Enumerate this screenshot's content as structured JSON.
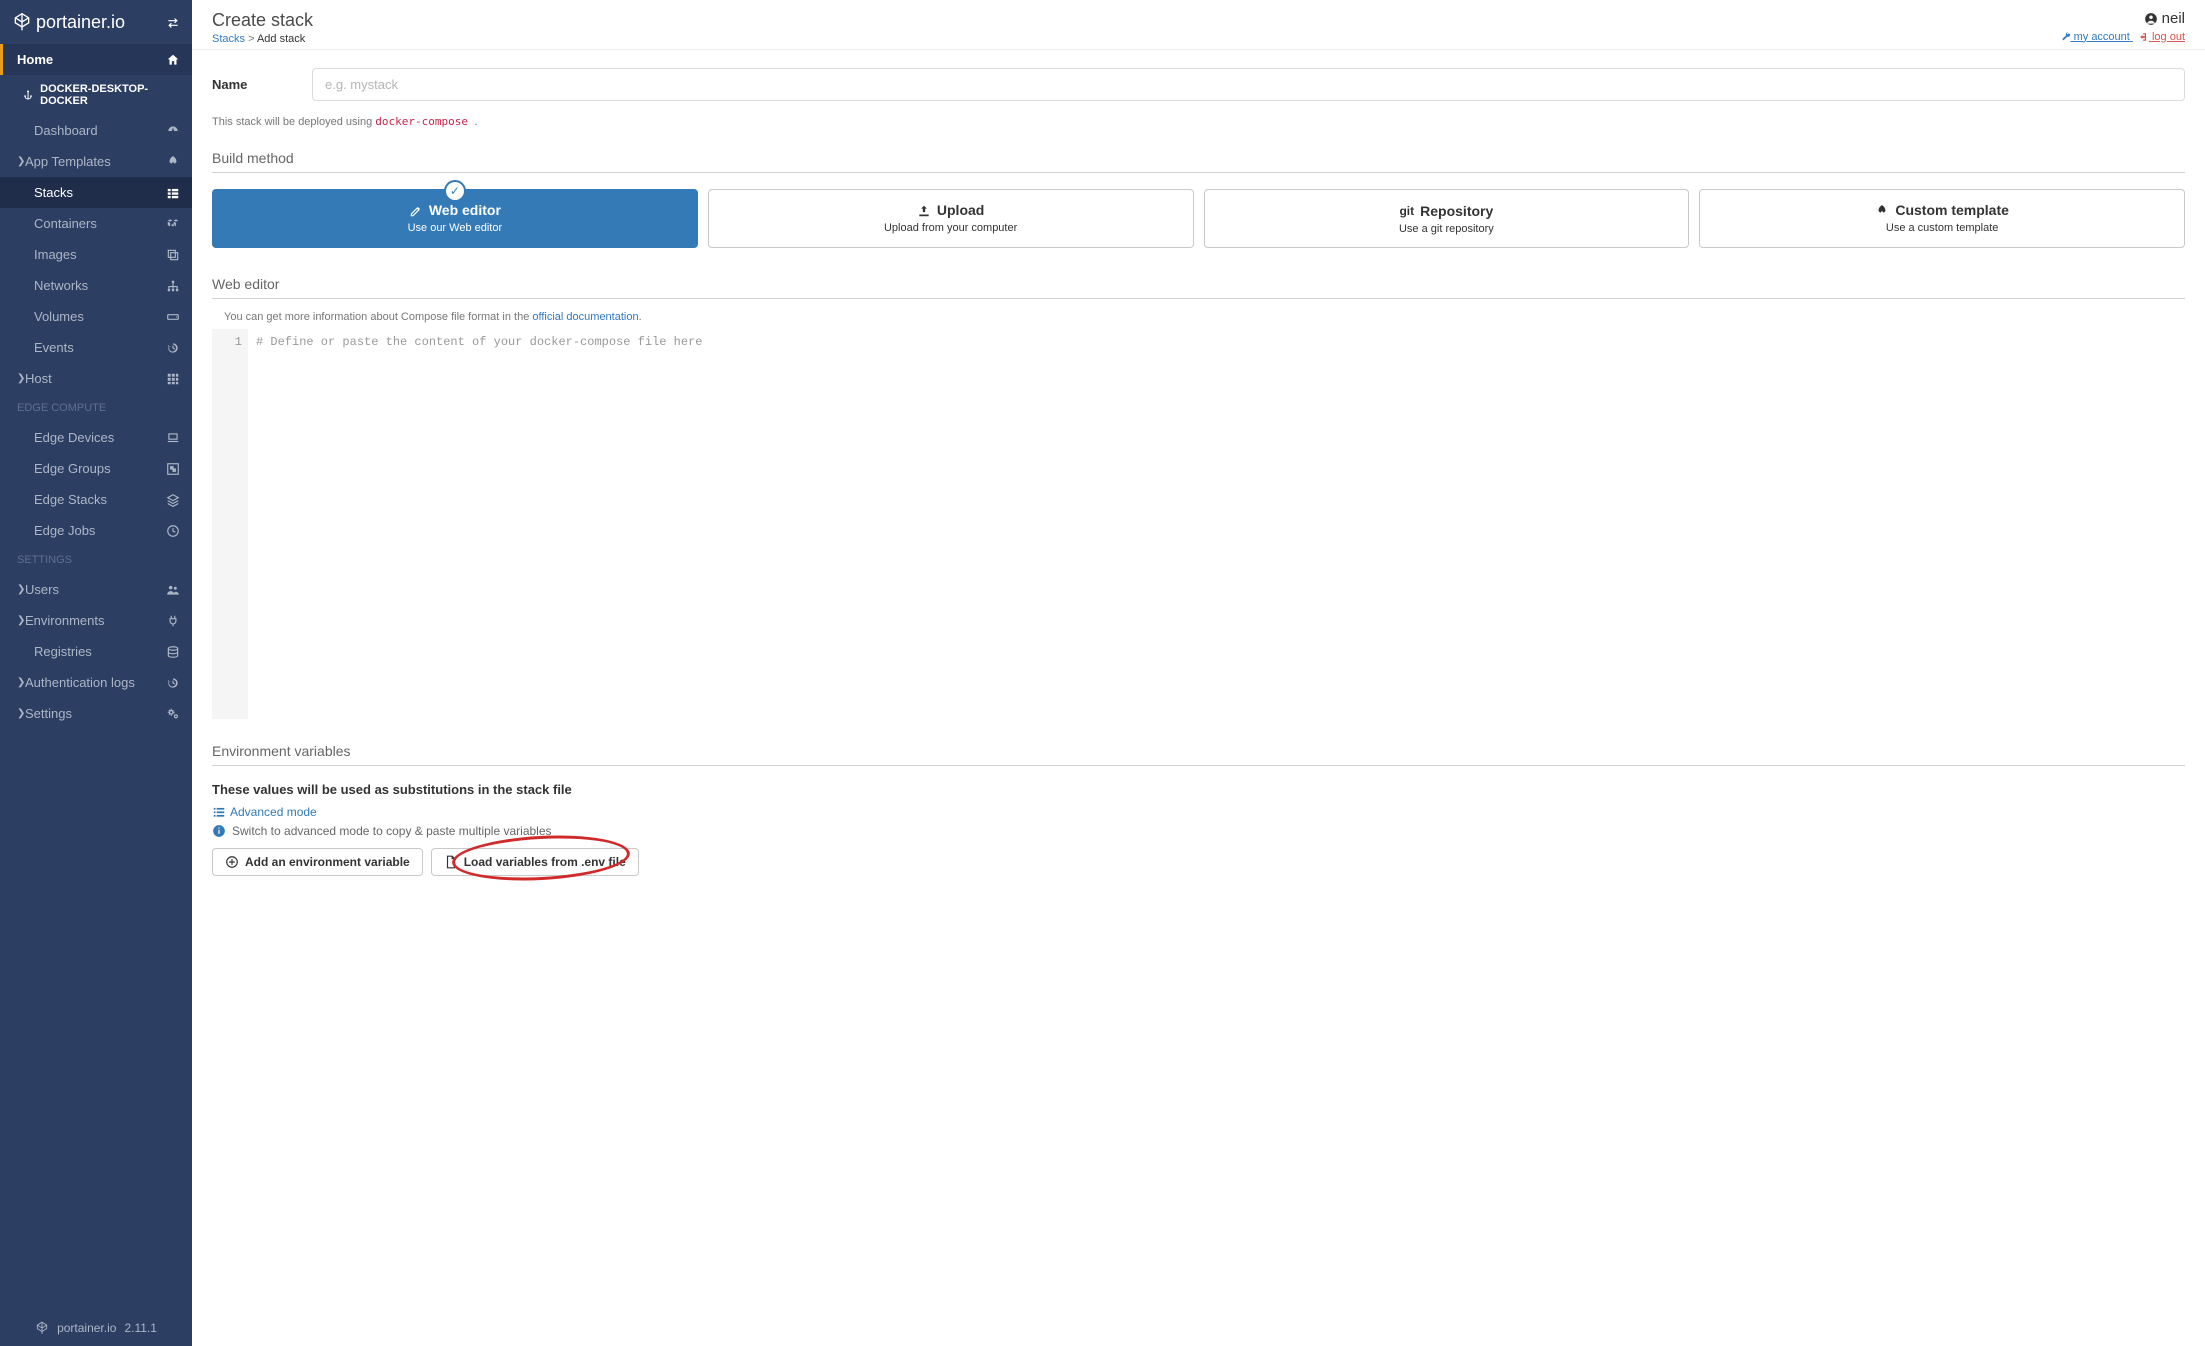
{
  "brand": {
    "name": "portainer.io",
    "version": "2.11.1"
  },
  "header": {
    "page_title": "Create stack",
    "breadcrumb_root": "Stacks",
    "breadcrumb_current": "Add stack",
    "user_name": "neil",
    "my_account_label": "my account",
    "logout_label": "log out"
  },
  "sidebar": {
    "home": "Home",
    "env_label": "DOCKER-DESKTOP-DOCKER",
    "items": [
      {
        "label": "Dashboard",
        "icon": "tachometer"
      },
      {
        "label": "App Templates",
        "icon": "rocket",
        "chev": true
      },
      {
        "label": "Stacks",
        "icon": "th-list",
        "active": true
      },
      {
        "label": "Containers",
        "icon": "cubes"
      },
      {
        "label": "Images",
        "icon": "clone"
      },
      {
        "label": "Networks",
        "icon": "sitemap"
      },
      {
        "label": "Volumes",
        "icon": "hdd"
      },
      {
        "label": "Events",
        "icon": "history"
      },
      {
        "label": "Host",
        "icon": "th",
        "chev": true
      }
    ],
    "section_edge": "EDGE COMPUTE",
    "edge_items": [
      {
        "label": "Edge Devices",
        "icon": "laptop"
      },
      {
        "label": "Edge Groups",
        "icon": "object-group"
      },
      {
        "label": "Edge Stacks",
        "icon": "layers"
      },
      {
        "label": "Edge Jobs",
        "icon": "clock"
      }
    ],
    "section_settings": "SETTINGS",
    "settings_items": [
      {
        "label": "Users",
        "icon": "users",
        "chev": true
      },
      {
        "label": "Environments",
        "icon": "plug",
        "chev": true
      },
      {
        "label": "Registries",
        "icon": "database"
      },
      {
        "label": "Authentication logs",
        "icon": "history",
        "chev": true
      },
      {
        "label": "Settings",
        "icon": "cogs",
        "chev": true
      }
    ]
  },
  "form": {
    "name_label": "Name",
    "name_placeholder": "e.g. mystack",
    "deploy_hint_prefix": "This stack will be deployed using ",
    "deploy_hint_code": "docker-compose ",
    "build_method_title": "Build method",
    "boxes": [
      {
        "title": "Web editor",
        "sub": "Use our Web editor",
        "icon": "edit",
        "active": true
      },
      {
        "title": "Upload",
        "sub": "Upload from your computer",
        "icon": "upload"
      },
      {
        "title": "Repository",
        "sub": "Use a git repository",
        "icon": "git"
      },
      {
        "title": "Custom template",
        "sub": "Use a custom template",
        "icon": "rocket"
      }
    ],
    "web_editor_title": "Web editor",
    "editor_help_prefix": "You can get more information about Compose file format in the ",
    "editor_help_link": "official documentation",
    "editor_placeholder": "# Define or paste the content of your docker-compose file here",
    "gutter_line": "1",
    "env_section_title": "Environment variables",
    "env_subheading": "These values will be used as substitutions in the stack file",
    "advanced_mode": "Advanced mode",
    "advanced_hint": "Switch to advanced mode to copy & paste multiple variables",
    "add_env_btn": "Add an environment variable",
    "load_env_btn": "Load variables from .env file"
  }
}
